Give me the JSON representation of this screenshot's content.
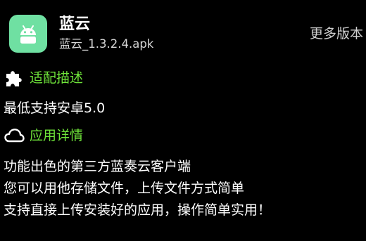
{
  "app": {
    "name": "蓝云",
    "file": "蓝云_1.3.2.4.apk",
    "icon": "android-icon",
    "icon_color": "#6fe0a2"
  },
  "header": {
    "more_versions": "更多版本"
  },
  "sections": [
    {
      "title": "适配描述",
      "icon": "puzzle-icon",
      "lines": [
        "最低支持安卓5.0"
      ]
    },
    {
      "title": "应用详情",
      "icon": "cloud-icon",
      "lines": [
        "功能出色的第三方蓝奏云客户端",
        "您可以用他存储文件，上传文件方式简单",
        "支持直接上传安装好的应用，操作简单实用！"
      ]
    }
  ],
  "colors": {
    "background": "#000000",
    "section_title": "#6fe43a",
    "text": "#ffffff",
    "secondary_text": "#d6d6d6"
  }
}
